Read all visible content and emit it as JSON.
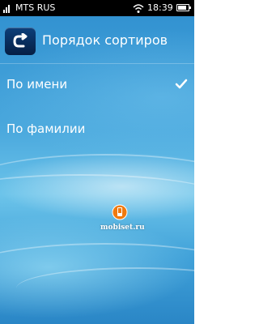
{
  "status_bar": {
    "carrier": "MTS RUS",
    "time": "18:39",
    "battery_level": 0.8
  },
  "header": {
    "title": "Порядок сортиров",
    "back_icon": "back-arrow-icon"
  },
  "options": [
    {
      "label": "По имени",
      "selected": true
    },
    {
      "label": "По фамилии",
      "selected": false
    }
  ],
  "watermark": {
    "text": "mobiset.ru"
  },
  "colors": {
    "status_bar_bg": "#000000",
    "back_button_bg": "#0c3f7a",
    "background_top": "#2f8fcf",
    "background_bottom": "#2a86c6"
  }
}
